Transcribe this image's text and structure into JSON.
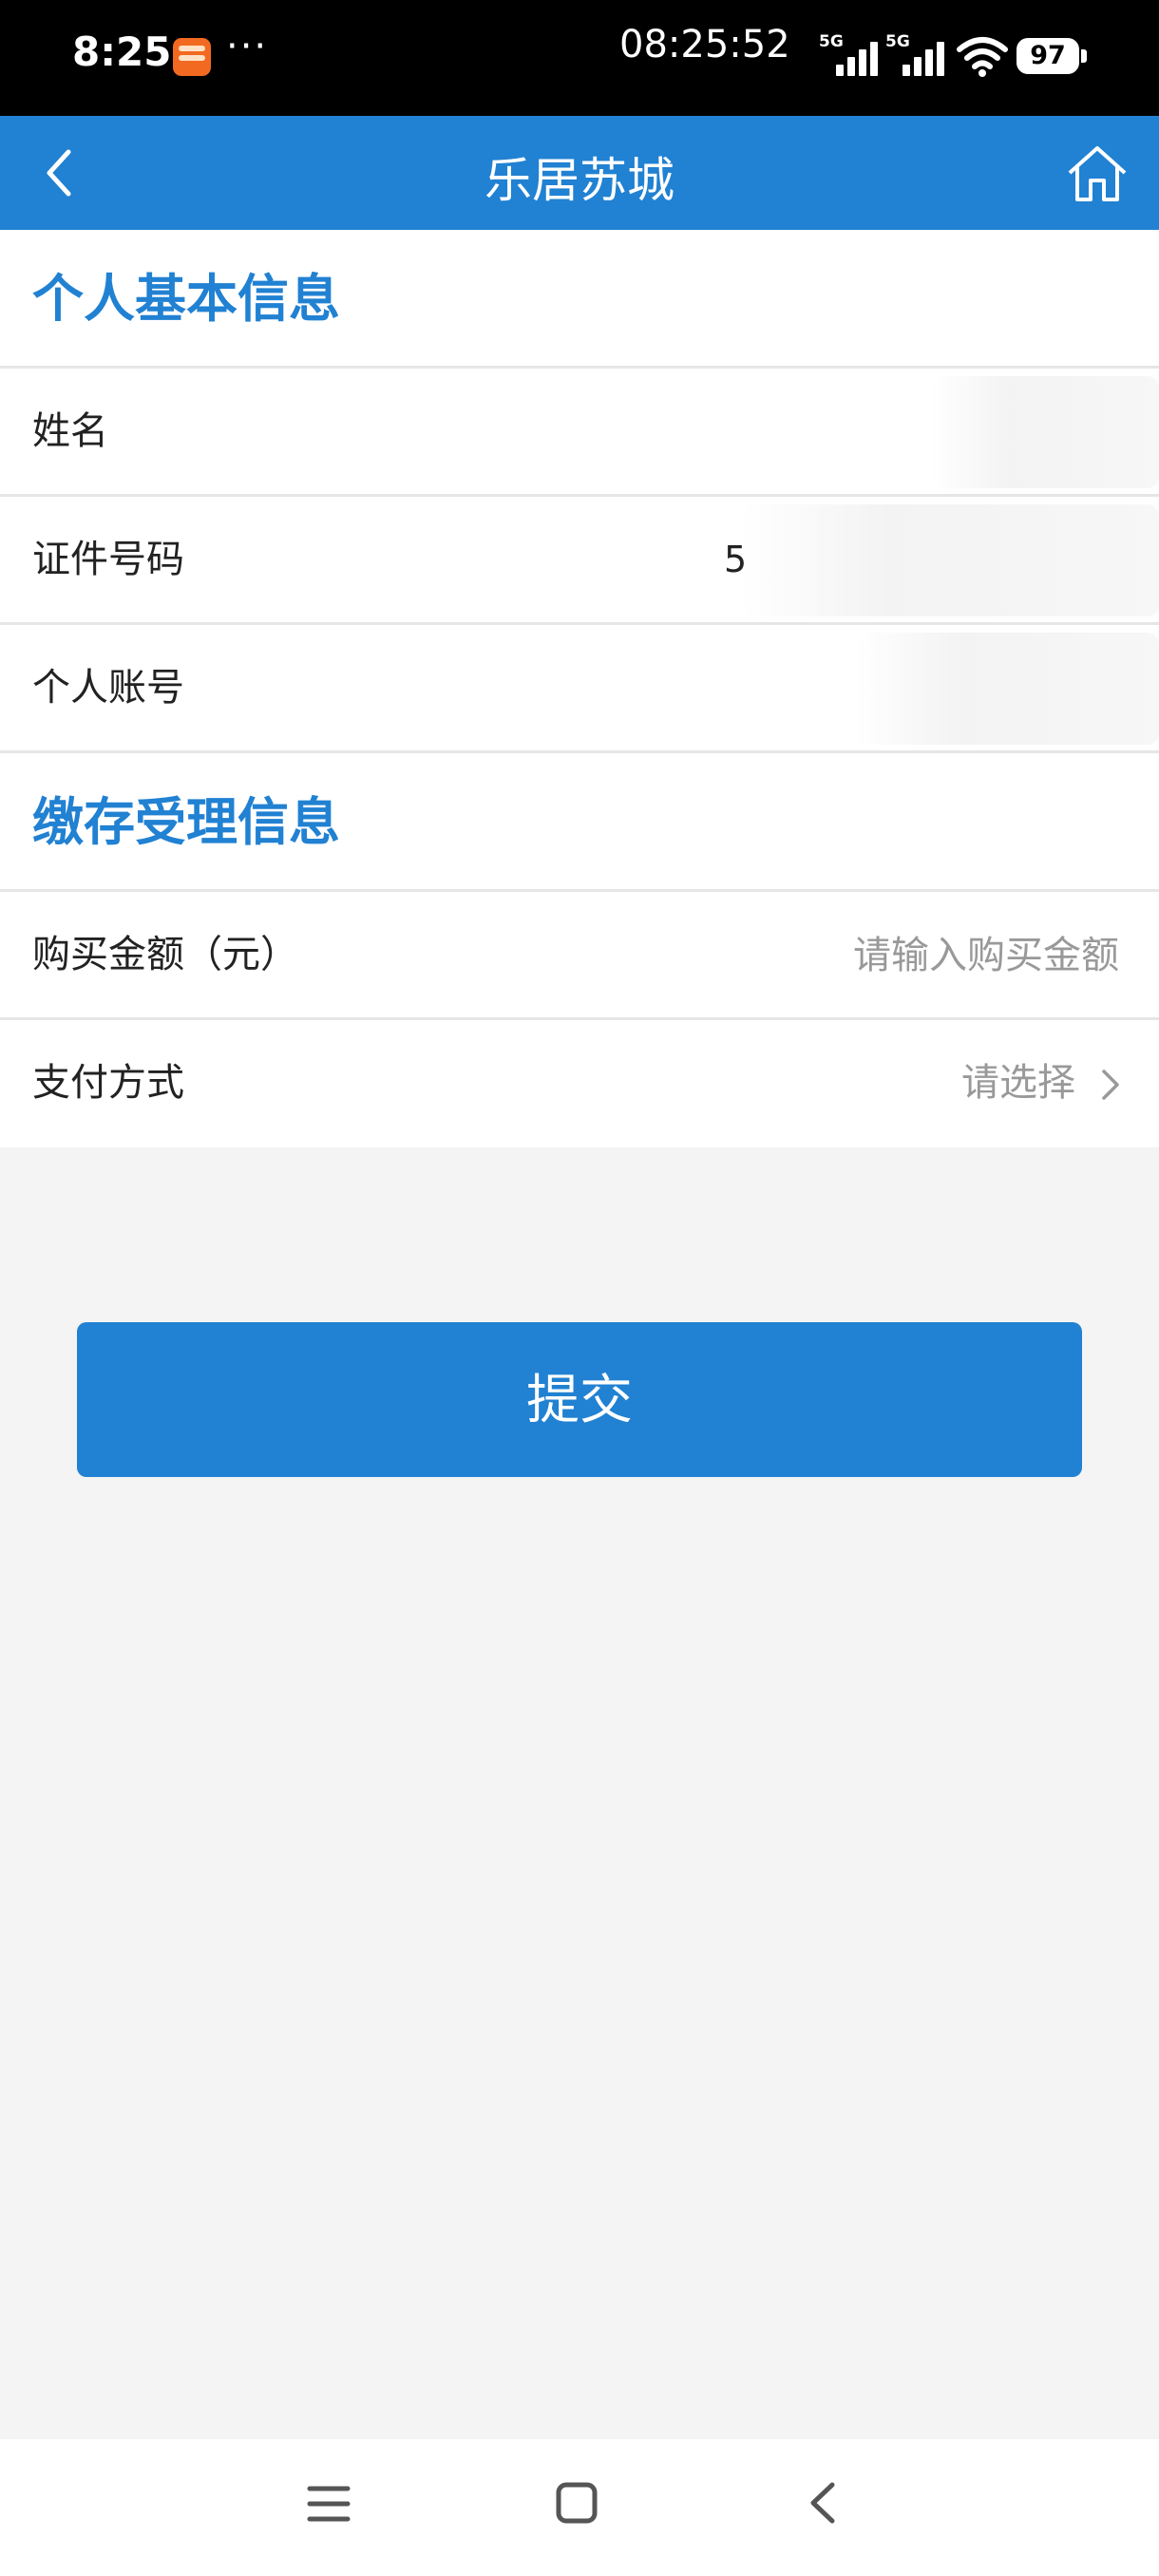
{
  "status_bar": {
    "time": "8:25",
    "more": "···",
    "clock": "08:25:52",
    "network_1": "5G",
    "network_2": "5G",
    "battery": "97",
    "app_icon": "orange-app-notification-icon"
  },
  "header": {
    "title": "乐居苏城",
    "back_icon": "chevron-left-icon",
    "home_icon": "home-icon"
  },
  "sections": {
    "personal": {
      "title": "个人基本信息",
      "name_label": "姓名",
      "id_label": "证件号码",
      "id_value_visible": "5",
      "account_label": "个人账号"
    },
    "deposit": {
      "title": "缴存受理信息",
      "amount_label": "购买金额（元）",
      "amount_placeholder": "请输入购买金额",
      "payment_label": "支付方式",
      "payment_value": "请选择"
    }
  },
  "submit_label": "提交",
  "nav": {
    "menu_icon": "menu-icon",
    "home_icon": "square-home-icon",
    "back_icon": "back-icon"
  },
  "colors": {
    "primary": "#2181d2",
    "background": "#f4f4f4",
    "placeholder": "#999999"
  }
}
